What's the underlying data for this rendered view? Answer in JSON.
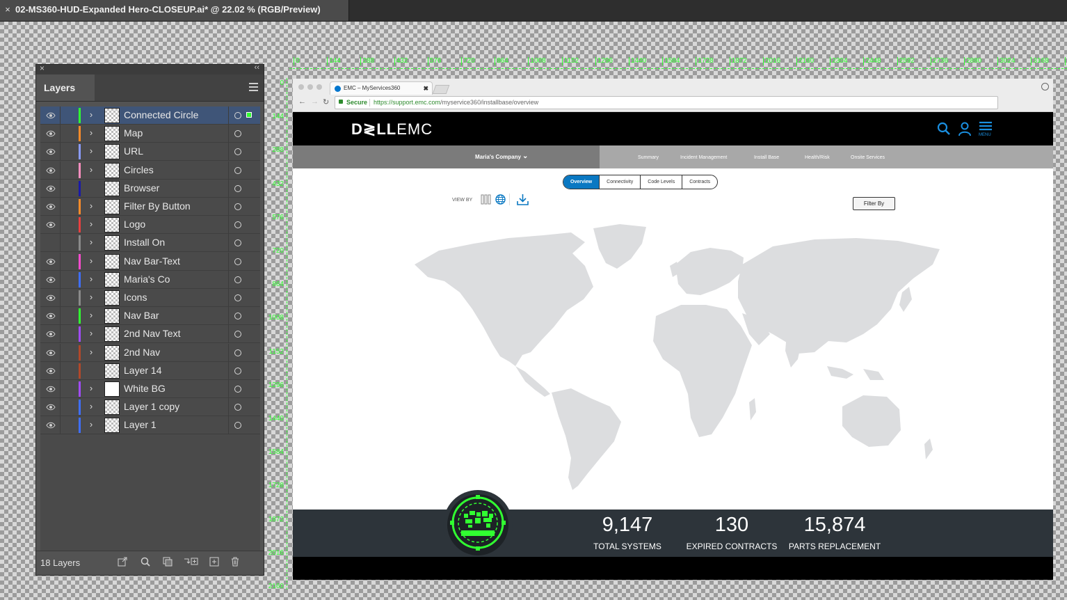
{
  "document": {
    "close": "×",
    "title": "02-MS360-HUD-Expanded Hero-CLOSEUP.ai* @ 22.02 % (RGB/Preview)"
  },
  "rulers": {
    "top": [
      "0",
      "144",
      "288",
      "432",
      "576",
      "720",
      "864",
      "1008",
      "1152",
      "1296",
      "1440",
      "1584",
      "1728",
      "1872",
      "2016",
      "2160",
      "2304",
      "2448",
      "2592",
      "2736",
      "2880",
      "3024",
      "3168",
      "3"
    ],
    "left": [
      "0",
      "144",
      "288",
      "432",
      "576",
      "720",
      "864",
      "1008",
      "1152",
      "1296",
      "1440",
      "1584",
      "1728",
      "1872",
      "2016",
      "2160"
    ],
    "color": "#31ff31"
  },
  "layers_panel": {
    "panel_close": "×",
    "collapse": "‹‹",
    "tab": "Layers",
    "footer_count": "18 Layers",
    "layers": [
      {
        "name": "Connected Circle",
        "color": "#31ff31",
        "visible": true,
        "expandable": true,
        "selected": true
      },
      {
        "name": "Map",
        "color": "#ff8c2a",
        "visible": true,
        "expandable": true
      },
      {
        "name": "URL",
        "color": "#8b9cff",
        "visible": true,
        "expandable": true
      },
      {
        "name": "Circles",
        "color": "#ff8fc0",
        "visible": true,
        "expandable": true
      },
      {
        "name": "Browser",
        "color": "#1a1aa8",
        "visible": true,
        "expandable": false
      },
      {
        "name": "Filter By Button",
        "color": "#ff8c2a",
        "visible": true,
        "expandable": true
      },
      {
        "name": "Logo",
        "color": "#e84040",
        "visible": true,
        "expandable": true
      },
      {
        "name": "Install On",
        "color": "#8a8a8a",
        "visible": false,
        "expandable": true
      },
      {
        "name": "Nav Bar-Text",
        "color": "#ff4ccf",
        "visible": true,
        "expandable": true
      },
      {
        "name": "Maria's Co",
        "color": "#3f6fff",
        "visible": true,
        "expandable": true
      },
      {
        "name": "Icons",
        "color": "#8a8a8a",
        "visible": true,
        "expandable": true
      },
      {
        "name": "Nav Bar",
        "color": "#31ff31",
        "visible": true,
        "expandable": true
      },
      {
        "name": "2nd Nav Text",
        "color": "#a24cff",
        "visible": true,
        "expandable": true
      },
      {
        "name": "2nd Nav",
        "color": "#b2482a",
        "visible": true,
        "expandable": true
      },
      {
        "name": "Layer 14",
        "color": "#b2482a",
        "visible": true,
        "expandable": false
      },
      {
        "name": "White BG",
        "color": "#a24cff",
        "visible": true,
        "expandable": true
      },
      {
        "name": "Layer 1 copy",
        "color": "#3f6fff",
        "visible": true,
        "expandable": true
      },
      {
        "name": "Layer 1",
        "color": "#3f6fff",
        "visible": true,
        "expandable": true
      }
    ],
    "footer_icons": [
      "export-icon",
      "search-icon",
      "clip-mask-icon",
      "new-sublayer-icon",
      "new-layer-icon",
      "trash-icon"
    ]
  },
  "browser": {
    "tab_title": "EMC – MyServices360",
    "tab_close": "✖",
    "secure": "Secure",
    "url_host": "https://support.emc.com",
    "url_path": "/myservice360/installbase/overview",
    "back": "←",
    "forward": "→",
    "reload": "↻"
  },
  "site": {
    "logo_dell": "D≷LL",
    "logo_emc": "EMC",
    "menu_label": "MENU",
    "company": "Maria's Company",
    "company_chevron": "⌄",
    "nav": [
      "Summary",
      "Incident Management",
      "Install Base",
      "Health/Risk",
      "Onsite Services"
    ],
    "tabs": [
      "Overview",
      "Connectivity",
      "Code Levels",
      "Contracts"
    ],
    "active_tab": "Overview",
    "view_by": "VIEW BY",
    "filter_by": "Filter By",
    "accent": "#0a78c2",
    "stats": [
      {
        "value": "9,147",
        "label": "TOTAL SYSTEMS"
      },
      {
        "value": "130",
        "label": "EXPIRED CONTRACTS"
      },
      {
        "value": "15,874",
        "label": "PARTS REPLACEMENT"
      }
    ],
    "hud_color": "#31ff31"
  }
}
